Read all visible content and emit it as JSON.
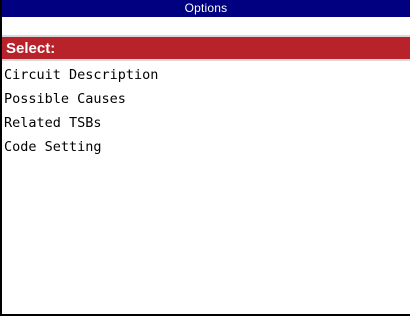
{
  "window": {
    "title": "Options"
  },
  "select_bar": {
    "label": "Select:"
  },
  "options": [
    {
      "label": "Circuit Description"
    },
    {
      "label": "Possible Causes"
    },
    {
      "label": "Related TSBs"
    },
    {
      "label": "Code Setting"
    }
  ],
  "colors": {
    "title_bar": "#000080",
    "select_bar": "#b8222b",
    "list_background": "#ffffff"
  }
}
